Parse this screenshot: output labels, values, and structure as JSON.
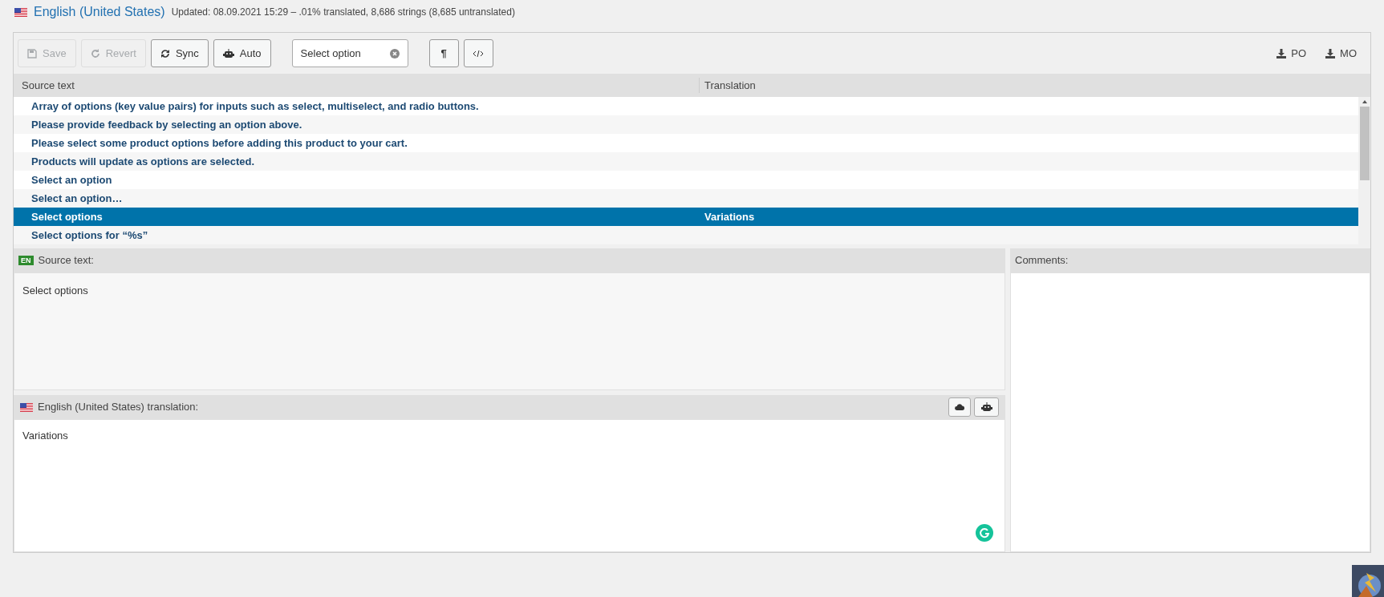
{
  "header": {
    "locale": "English (United States)",
    "summary": "Updated: 08.09.2021 15:29 – .01% translated, 8,686 strings (8,685 untranslated)"
  },
  "toolbar": {
    "buttons": [
      {
        "kind": "save",
        "label": "Save",
        "disabled": true
      },
      {
        "kind": "revert",
        "label": "Revert",
        "disabled": true
      },
      {
        "kind": "sync",
        "label": "Sync",
        "disabled": false
      },
      {
        "kind": "auto",
        "label": "Auto",
        "disabled": false
      }
    ],
    "filter": {
      "placeholder": "Select option"
    },
    "toggles": [
      {
        "kind": "pilcrow",
        "label": "¶"
      },
      {
        "kind": "code"
      }
    ],
    "downloads": [
      "PO",
      "MO"
    ]
  },
  "table": {
    "columns": [
      "Source text",
      "Translation"
    ],
    "rows": [
      {
        "source": "Array of options (key value pairs) for inputs such as select, multiselect, and radio buttons.",
        "selected": false
      },
      {
        "source": "Please provide feedback by selecting an option above.",
        "selected": false
      },
      {
        "source": "Please select some product options before adding this product to your cart.",
        "selected": false
      },
      {
        "source": "Products will update as options are selected.",
        "selected": false
      },
      {
        "source": "Select an option",
        "selected": false
      },
      {
        "source": "Select an option…",
        "selected": false
      },
      {
        "source": "Select options",
        "translation": "Variations",
        "selected": true
      },
      {
        "source": "Select options for “%s”",
        "selected": false
      }
    ]
  },
  "source_panel": {
    "lang_badge": "EN",
    "title": "Source text:",
    "text": "Select options"
  },
  "translation_panel": {
    "title": "English (United States) translation:",
    "value": "Variations"
  },
  "comments_panel": {
    "title": "Comments:"
  }
}
